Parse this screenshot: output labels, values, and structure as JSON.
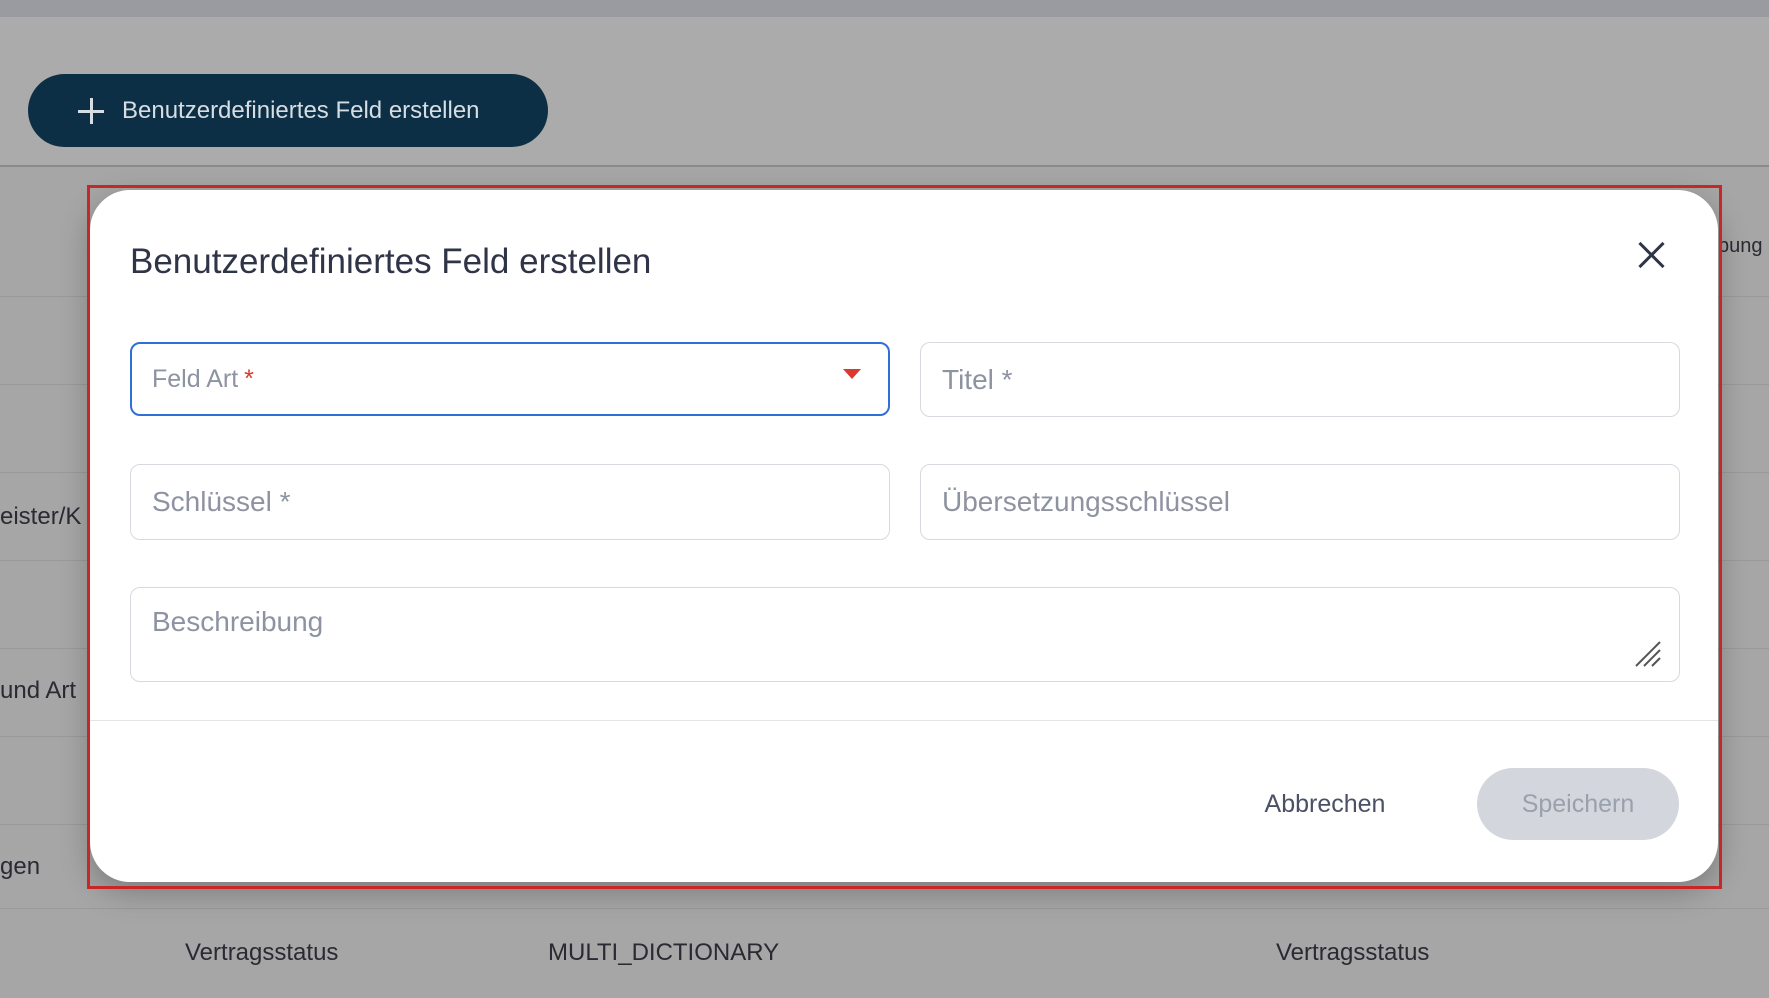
{
  "toolbar": {
    "create_button_label": "Benutzerdefiniertes Feld erstellen"
  },
  "background_table": {
    "fragments": [
      "bung",
      "eister/K",
      "und Art",
      "gen"
    ],
    "row": {
      "name": "Vertragsstatus",
      "type": "MULTI_DICTIONARY",
      "translation": "Vertragsstatus"
    }
  },
  "dialog": {
    "title": "Benutzerdefiniertes Feld erstellen",
    "fields": {
      "field_type": {
        "placeholder": "Feld Art",
        "required_mark": "*"
      },
      "title": {
        "placeholder": "Titel *"
      },
      "key": {
        "placeholder": "Schlüssel *"
      },
      "translation_key": {
        "placeholder": "Übersetzungsschlüssel"
      },
      "description": {
        "placeholder": "Beschreibung"
      }
    },
    "actions": {
      "cancel": "Abbrechen",
      "save": "Speichern"
    }
  },
  "colors": {
    "primary": "#0d2f45",
    "focus": "#2f6fd6",
    "required": "#d83a2e",
    "disabled": "#d3d6dc"
  }
}
